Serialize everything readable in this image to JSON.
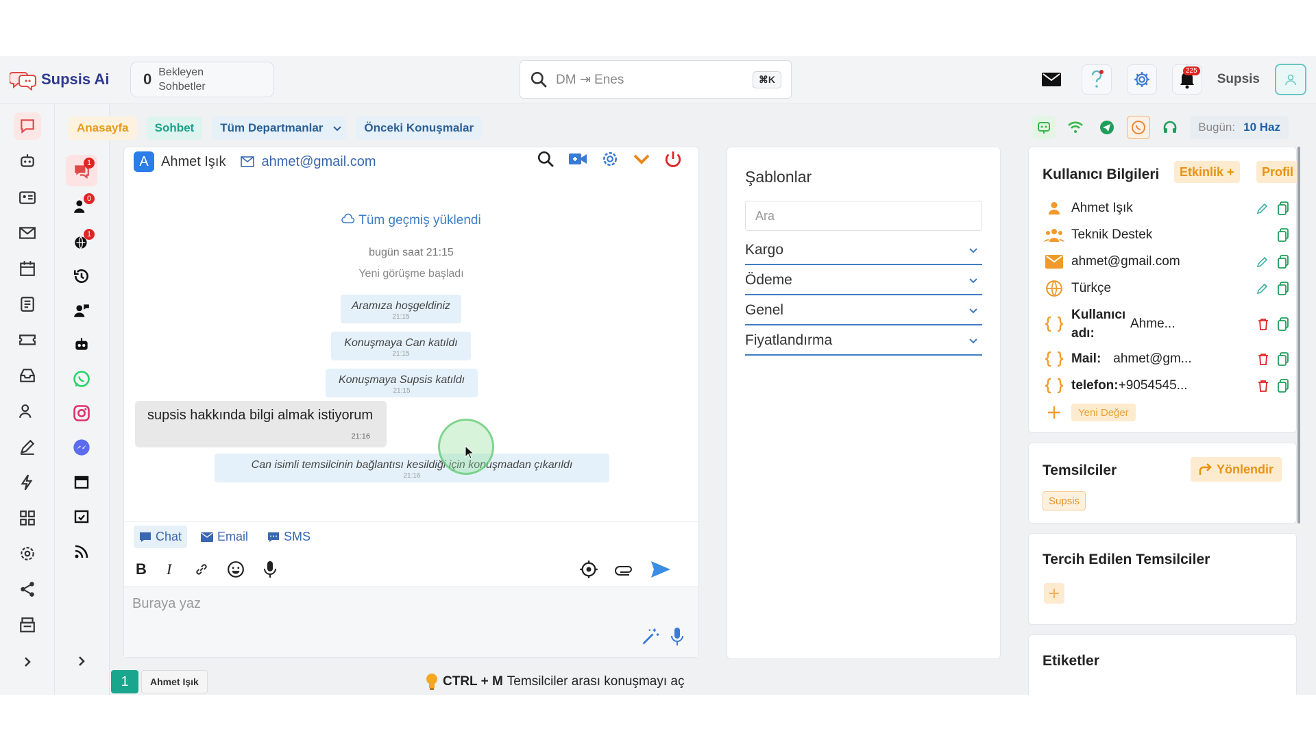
{
  "brand": {
    "name": "Supsis Ai"
  },
  "pending": {
    "count": "0",
    "label": "Bekleyen Sohbetler"
  },
  "search": {
    "placeholder": "DM ⇥ Enes",
    "shortcut": "⌘K"
  },
  "topbar": {
    "user_name": "Supsis",
    "notifications_count": "225"
  },
  "nav_tabs": [
    {
      "label": "Anasayfa"
    },
    {
      "label": "Sohbet"
    },
    {
      "label": "Tüm Departmanlar"
    },
    {
      "label": "Önceki Konuşmalar"
    }
  ],
  "today": {
    "label": "Bugün:",
    "value": "10 Haz"
  },
  "rail2_badges": [
    "1",
    "0",
    "1"
  ],
  "chat": {
    "avatar_letter": "A",
    "user_name": "Ahmet Işık",
    "user_email": "ahmet@gmail.com",
    "history_loaded": "Tüm geçmiş yüklendi",
    "time_label": "bugün saat 21:15",
    "new_conversation": "Yeni görüşme başladı",
    "events": [
      {
        "text": "Aramıza hoşgeldiniz",
        "time": "21:15"
      },
      {
        "text": "Konuşmaya Can katıldı",
        "time": "21:15"
      },
      {
        "text": "Konuşmaya Supsis katıldı",
        "time": "21:15"
      }
    ],
    "message": {
      "text": "supsis hakkında bilgi almak istiyorum",
      "time": "21:16"
    },
    "disconnect_event": {
      "text": "Can isimli temsilcinin bağlantısı kesildiği için konuşmadan çıkarıldı",
      "time": "21:16"
    },
    "composer_tabs": [
      {
        "label": "Chat"
      },
      {
        "label": "Email"
      },
      {
        "label": "SMS"
      }
    ],
    "input_placeholder": "Buraya yaz"
  },
  "footer": {
    "tab_number": "1",
    "tab_name": "Ahmet Işık",
    "hint_keys": "CTRL + M",
    "hint_text": "Temsilciler arası konuşmayı aç"
  },
  "templates": {
    "title": "Şablonlar",
    "search_placeholder": "Ara",
    "items": [
      {
        "label": "Kargo"
      },
      {
        "label": "Ödeme"
      },
      {
        "label": "Genel"
      },
      {
        "label": "Fiyatlandırma"
      }
    ]
  },
  "user_info": {
    "title": "Kullanıcı Bilgileri",
    "activity_label": "Etkinlik +",
    "profile_label": "Profil",
    "name": "Ahmet Işık",
    "department": "Teknik Destek",
    "email": "ahmet@gmail.com",
    "language": "Türkçe",
    "fields": [
      {
        "key": "Kullanıcı adı:",
        "value": "Ahme..."
      },
      {
        "key": "Mail:",
        "value": "ahmet@gm..."
      },
      {
        "key": "telefon:",
        "value": "+9054545..."
      }
    ],
    "new_value_label": "Yeni Değer"
  },
  "agents": {
    "title": "Temsilciler",
    "redirect_label": "Yönlendir",
    "agent_tag": "Supsis"
  },
  "preferred_agents": {
    "title": "Tercih Edilen Temsilciler"
  },
  "tags": {
    "title": "Etiketler"
  },
  "colors": {
    "accent_blue": "#3f7dc4",
    "accent_orange": "#e89312",
    "accent_teal": "#1aa58d",
    "danger": "#e02424"
  }
}
